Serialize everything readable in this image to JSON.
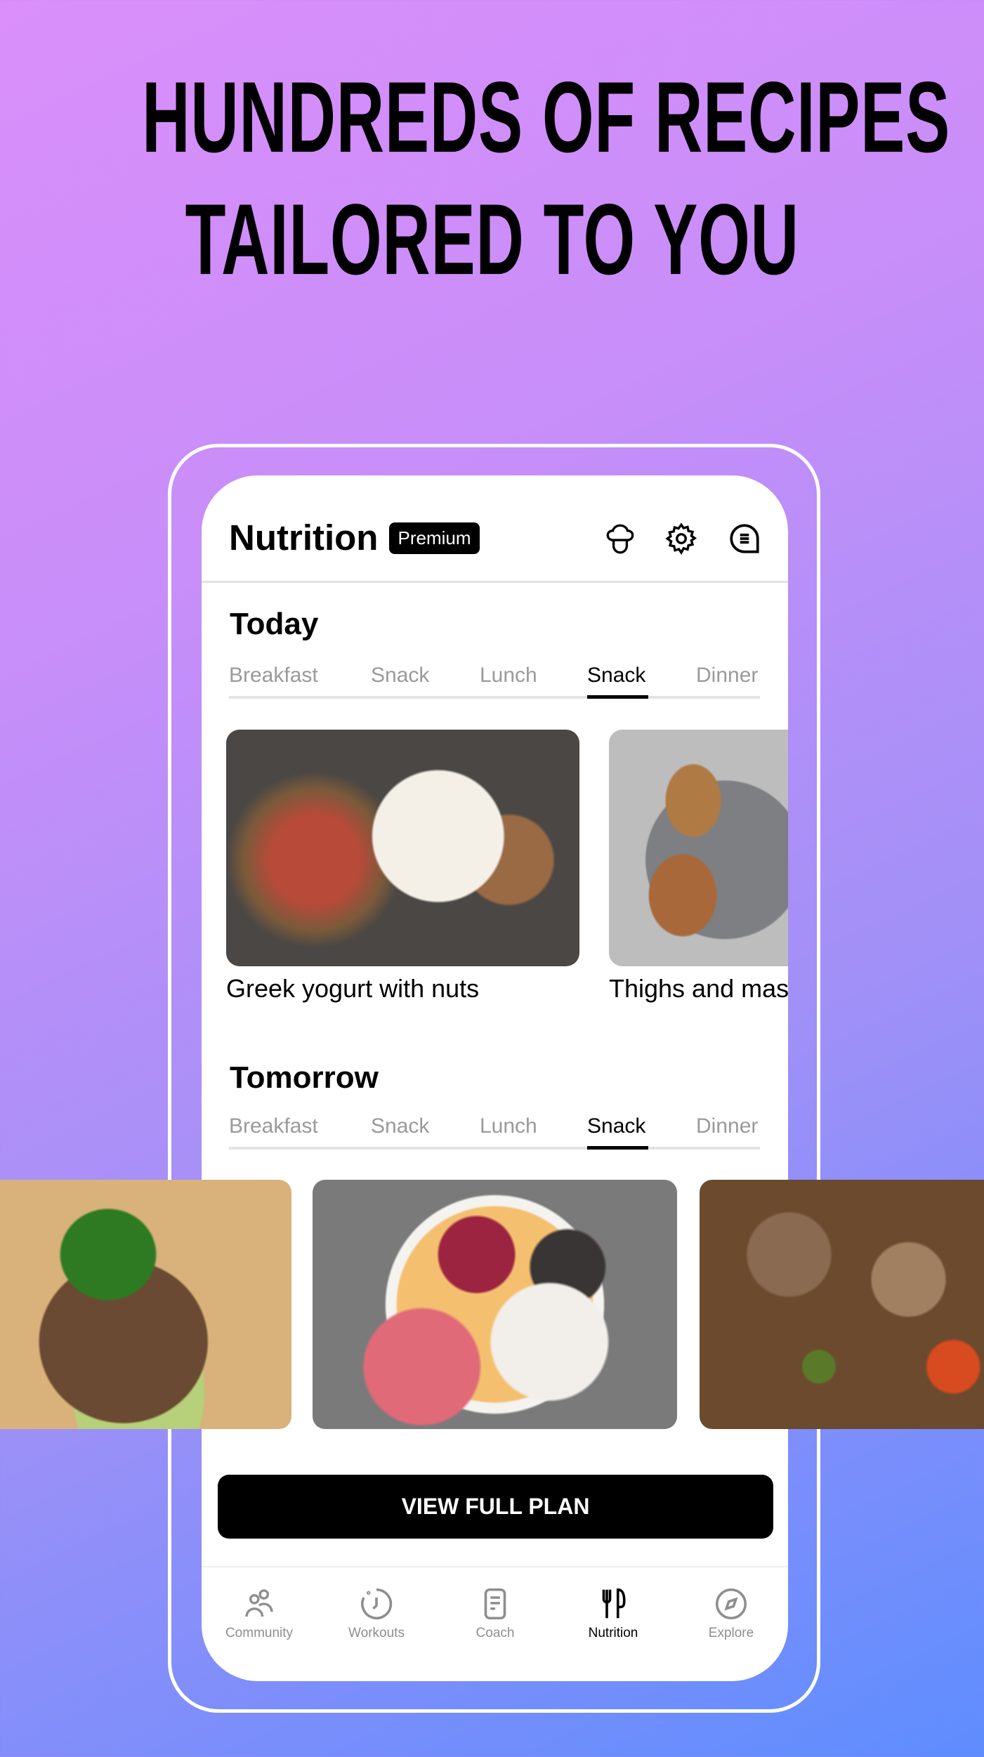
{
  "headline": {
    "line1": "HUNDREDS OF RECIPES",
    "line2": "TAILORED TO YOU"
  },
  "header": {
    "title": "Nutrition",
    "badge": "Premium",
    "icons": [
      "chef-hat-icon",
      "gear-icon",
      "chat-icon"
    ]
  },
  "today": {
    "title": "Today",
    "tabs": [
      "Breakfast",
      "Snack",
      "Lunch",
      "Snack",
      "Dinner"
    ],
    "active_tab_index": 3,
    "cards": [
      {
        "caption": "Greek yogurt with nuts",
        "image": "yogurt-bowl-image"
      },
      {
        "caption": "Thighs and mas",
        "image": "chicken-thighs-image"
      }
    ]
  },
  "tomorrow": {
    "title": "Tomorrow",
    "tabs": [
      "Breakfast",
      "Snack",
      "Lunch",
      "Snack",
      "Dinner"
    ],
    "active_tab_index": 3,
    "images": [
      "burger-image",
      "smoothie-bowl-image",
      "mushroom-quinoa-image"
    ]
  },
  "cta": {
    "label": "VIEW FULL PLAN"
  },
  "bottom_nav": {
    "items": [
      {
        "label": "Community",
        "icon": "community-icon"
      },
      {
        "label": "Workouts",
        "icon": "timer-icon"
      },
      {
        "label": "Coach",
        "icon": "document-icon"
      },
      {
        "label": "Nutrition",
        "icon": "fork-knife-icon"
      },
      {
        "label": "Explore",
        "icon": "compass-icon"
      }
    ],
    "active_index": 3
  },
  "colors": {
    "background_start": "#da8ffa",
    "background_end": "#5e8dfe",
    "accent": "#000000",
    "inactive": "#9a9a9a"
  }
}
